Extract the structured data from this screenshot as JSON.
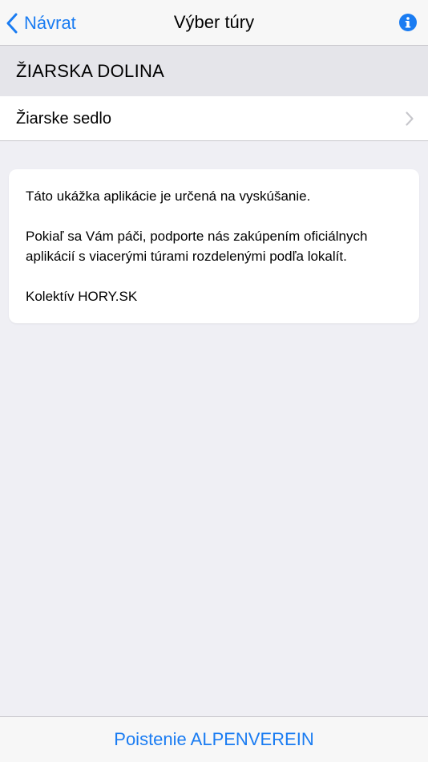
{
  "colors": {
    "accent": "#1a7cf2",
    "chevron": "#c7c7cc"
  },
  "nav": {
    "back_label": "Návrat",
    "back_icon": "chevron-left-icon",
    "title": "Výber túry",
    "info_icon": "info-icon"
  },
  "section": {
    "header": "ŽIARSKA DOLINA",
    "items": [
      {
        "label": "Žiarske sedlo",
        "icon": "chevron-right-icon"
      }
    ]
  },
  "notice": {
    "paragraph_1": "Táto ukážka aplikácie je určená na vyskúšanie.",
    "paragraph_2": "Pokiaľ sa Vám páči, podporte nás zakúpením oficiálnych aplikácií s viacerými túrami rozdelenými podľa lokalít.",
    "signature": "Kolektív HORY.SK"
  },
  "footer": {
    "link_label": "Poistenie ALPENVEREIN"
  }
}
